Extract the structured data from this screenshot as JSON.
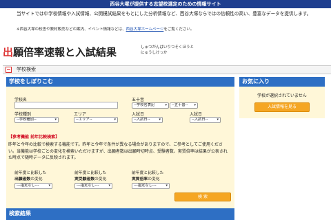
{
  "top_banner": "西谷大塚が提供する志望校選定のための情報サイト",
  "intro": {
    "line1": "当サイトでは中学校情報や入試情報、公開模試結果をもとにした分析情報など、西谷大塚ならではの信頼性の高い、豊富なデータを提供します。",
    "note_prefix": "※西谷大塚の校舎や教材販売などの案内、イベント情報などは、",
    "note_link": "西谷大塚ホームページ",
    "note_suffix": "をご覧ください。"
  },
  "page_title": {
    "first_char": "出",
    "rest": "願倍率速報と入試結果",
    "ruby_line1": "しゅつがんばいりつそくほうと",
    "ruby_line2": "にゅうしけっか"
  },
  "breadcrumb": {
    "label": "学校検索"
  },
  "search_panel": {
    "header": "学校をしぼりこむ",
    "school_name_label": "学校名",
    "gojuon_label": "五十音",
    "gojuon_select_1": "--学校名表記",
    "gojuon_select_2": "--五十音--",
    "school_type_label": "学校種別",
    "school_type_select": "--学校種別--",
    "area_label": "エリア",
    "area_select": "--エリア--",
    "entrance_date_label_1": "入試日",
    "entrance_date_select_1": "--入試日--",
    "entrance_date_label_2": "入試日",
    "entrance_date_select_2": "--入試日--",
    "ref_title": "【参考機能 前年比較検索】",
    "ref_body_1": "昨年と今年の比較で検索する機能です。昨年と今年で条件が異なる場合がありますので、ご参考としてご使用ください。",
    "ref_body_2": "当機能は学校ごとの変化を検索いただけますが、出願者数は出願時切時点、受験者数、実質倍率は結果が公表された時点で随時データに反映されます。",
    "compare_prefix": "前年度と比較した",
    "cmp1_bold": "出願者数",
    "cmp1_suffix": "の変化",
    "cmp2_bold": "実受験者数",
    "cmp2_suffix": "の変化",
    "cmp3_bold": "実質倍率",
    "cmp3_suffix": "の変化",
    "cmp_select": "---指定なし---",
    "search_button": "検 索"
  },
  "favorites": {
    "header": "お気に入り",
    "empty_message": "学校が選択されていません",
    "view_button": "入試情報を見る"
  },
  "results": {
    "header": "検索結果"
  }
}
